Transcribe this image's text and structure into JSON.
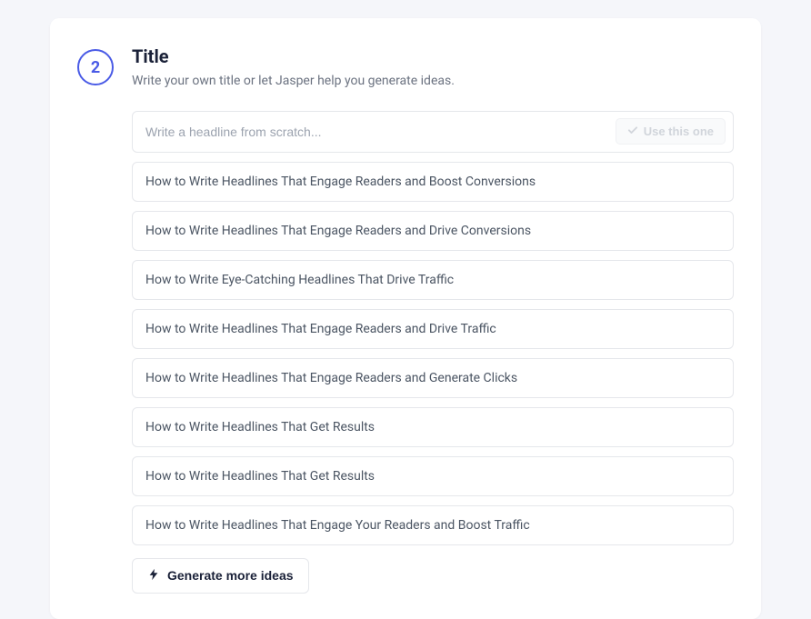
{
  "step": {
    "number": "2",
    "title": "Title",
    "subtitle": "Write your own title or let Jasper help you generate ideas."
  },
  "input": {
    "placeholder": "Write a headline from scratch...",
    "use_button_label": "Use this one"
  },
  "suggestions": [
    "How to Write Headlines That Engage Readers and Boost Conversions",
    "How to Write Headlines That Engage Readers and Drive Conversions",
    "How to Write Eye-Catching Headlines That Drive Traffic",
    "How to Write Headlines That Engage Readers and Drive Traffic",
    "How to Write Headlines That Engage Readers and Generate Clicks",
    "How to Write Headlines That Get Results",
    "How to Write Headlines That Get Results",
    "How to Write Headlines That Engage Your Readers and Boost Traffic"
  ],
  "generate_button_label": "Generate more ideas"
}
